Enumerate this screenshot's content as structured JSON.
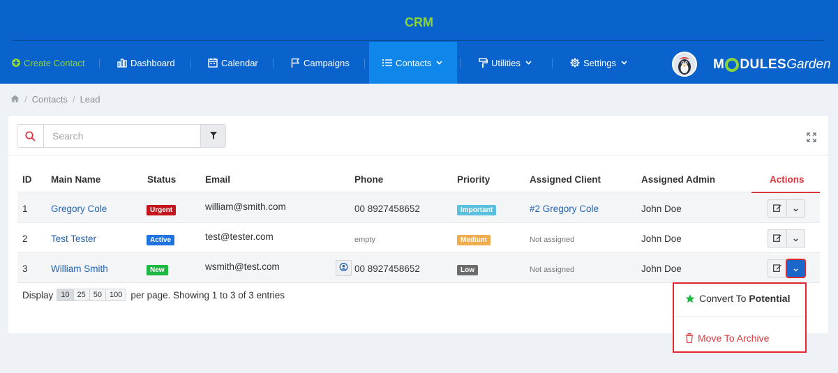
{
  "header": {
    "title": "CRM",
    "nav": [
      {
        "label": "Create Contact",
        "icon": "plus-circle-icon"
      },
      {
        "label": "Dashboard",
        "icon": "bar-chart-icon"
      },
      {
        "label": "Calendar",
        "icon": "calendar-icon"
      },
      {
        "label": "Campaigns",
        "icon": "flag-icon"
      },
      {
        "label": "Contacts",
        "icon": "list-icon"
      },
      {
        "label": "Utilities",
        "icon": "paint-roller-icon"
      },
      {
        "label": "Settings",
        "icon": "gear-icon"
      }
    ],
    "logo": {
      "part1": "M",
      "part2": "DULES",
      "part3": "Garden"
    }
  },
  "breadcrumb": {
    "home": "home-icon",
    "items": [
      "Contacts",
      "Lead"
    ]
  },
  "search": {
    "placeholder": "Search"
  },
  "table": {
    "columns": [
      "ID",
      "Main Name",
      "Status",
      "Email",
      "Phone",
      "Priority",
      "Assigned Client",
      "Assigned Admin",
      "Actions"
    ],
    "rows": [
      {
        "id": "1",
        "name": "Gregory Cole",
        "status": "Urgent",
        "email": "william@smith.com",
        "phone": "00 8927458652",
        "priority": "Important",
        "client": "#2 Gregory Cole",
        "admin": "John Doe"
      },
      {
        "id": "2",
        "name": "Test Tester",
        "status": "Active",
        "email": "test@tester.com",
        "phone": "empty",
        "priority": "Medium",
        "client": "Not assigned",
        "admin": "John Doe"
      },
      {
        "id": "3",
        "name": "William Smith",
        "status": "New",
        "email": "wsmith@test.com",
        "phone": "00 8927458652",
        "priority": "Low",
        "client": "Not assigned",
        "admin": "John Doe"
      }
    ]
  },
  "footer": {
    "display": "Display",
    "page_sizes": [
      "10",
      "25",
      "50",
      "100"
    ],
    "selected_page_size": "10",
    "summary": "per page. Showing 1 to 3 of 3 entries"
  },
  "dropdown": {
    "convert_prefix": "Convert To ",
    "convert_target": "Potential",
    "archive": "Move To Archive"
  },
  "colors": {
    "header_bg": "#0a62cc",
    "accent_green": "#8cd43c",
    "urgent": "#c4151c",
    "active": "#1d74e0",
    "new": "#1fb845",
    "important": "#5bc0de",
    "medium": "#f0ad4e",
    "low": "#6b6b6b",
    "danger": "#d9363e"
  }
}
